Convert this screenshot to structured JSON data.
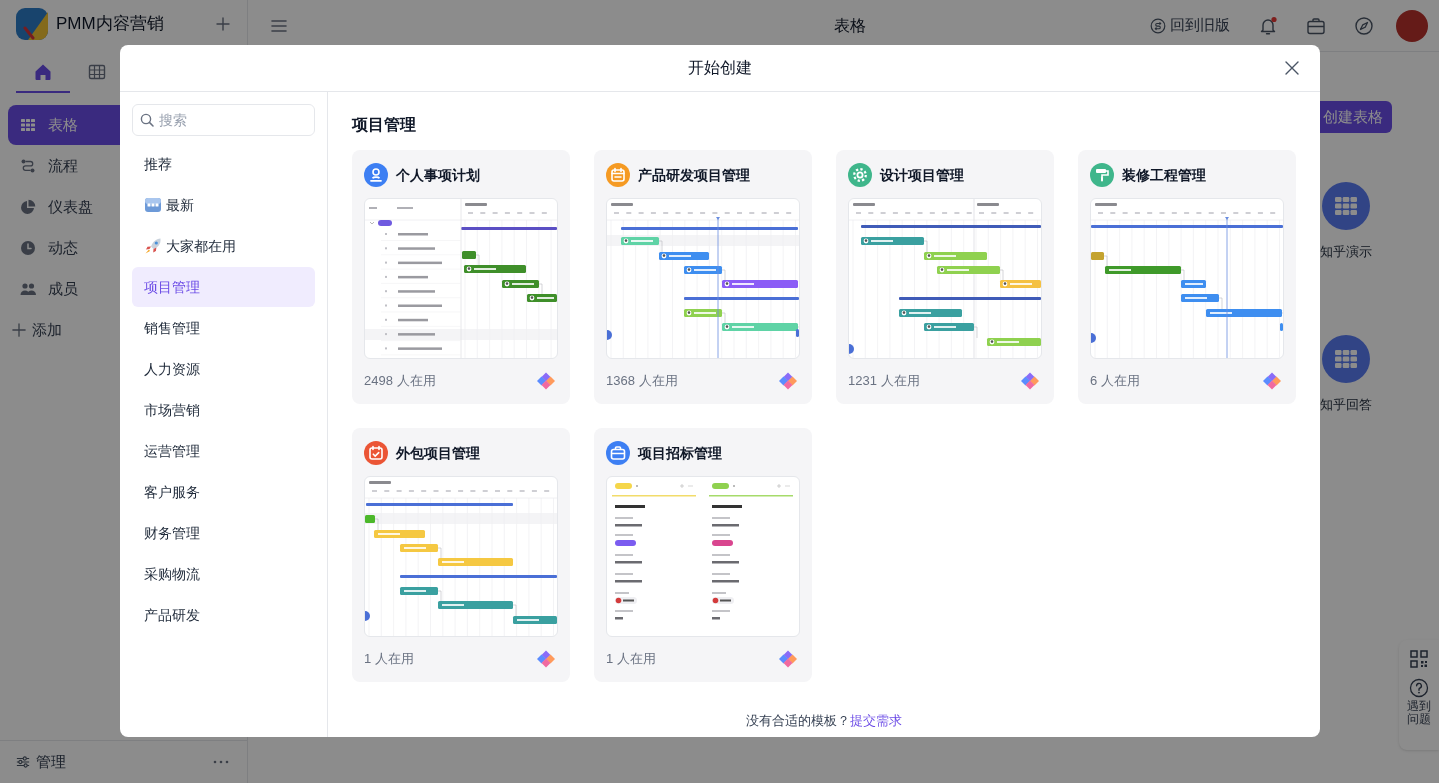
{
  "app": {
    "name": "PMM内容营销"
  },
  "header": {
    "title": "表格",
    "old_version": "回到旧版",
    "bell_unread": true
  },
  "sidebar": {
    "tabs": [
      {
        "selected": true
      },
      {
        "selected": false
      }
    ],
    "items": [
      {
        "label": "表格",
        "selected": true
      },
      {
        "label": "流程",
        "selected": false
      },
      {
        "label": "仪表盘",
        "selected": false
      },
      {
        "label": "动态",
        "selected": false
      },
      {
        "label": "成员",
        "selected": false
      }
    ],
    "add_label": "添加",
    "footer_label": "管理"
  },
  "workspace": {
    "create_button": "创建表格",
    "apps": [
      {
        "label": "知乎演示"
      },
      {
        "label": "知乎回答"
      }
    ]
  },
  "help": {
    "label": "遇到问题"
  },
  "modal": {
    "title": "开始创建",
    "search": {
      "placeholder": "搜索"
    },
    "nav": [
      {
        "label": "推荐",
        "kind": "plain",
        "selected": false
      },
      {
        "label": "最新",
        "kind": "new",
        "selected": false
      },
      {
        "label": "大家都在用",
        "kind": "popular",
        "selected": false
      },
      {
        "label": "项目管理",
        "kind": "plain",
        "selected": true
      },
      {
        "label": "销售管理",
        "kind": "plain",
        "selected": false
      },
      {
        "label": "人力资源",
        "kind": "plain",
        "selected": false
      },
      {
        "label": "市场营销",
        "kind": "plain",
        "selected": false
      },
      {
        "label": "运营管理",
        "kind": "plain",
        "selected": false
      },
      {
        "label": "客户服务",
        "kind": "plain",
        "selected": false
      },
      {
        "label": "财务管理",
        "kind": "plain",
        "selected": false
      },
      {
        "label": "采购物流",
        "kind": "plain",
        "selected": false
      },
      {
        "label": "产品研发",
        "kind": "plain",
        "selected": false
      }
    ],
    "section_title": "项目管理",
    "templates": [
      {
        "title": "个人事项计划",
        "users": "2498 人在用",
        "color": "#3d7ff3",
        "kind": "gantt"
      },
      {
        "title": "产品研发项目管理",
        "users": "1368 人在用",
        "color": "#f59a23",
        "kind": "gantt"
      },
      {
        "title": "设计项目管理",
        "users": "1231 人在用",
        "color": "#3fb68b",
        "kind": "gantt"
      },
      {
        "title": "装修工程管理",
        "users": "6 人在用",
        "color": "#3fb68b",
        "kind": "gantt"
      },
      {
        "title": "外包项目管理",
        "users": "1 人在用",
        "color": "#eb5535",
        "kind": "gantt"
      },
      {
        "title": "项目招标管理",
        "users": "1 人在用",
        "color": "#3d7ff3",
        "kind": "kanban"
      }
    ],
    "footer": {
      "text": "没有合适的模板？",
      "link": "提交需求"
    }
  }
}
